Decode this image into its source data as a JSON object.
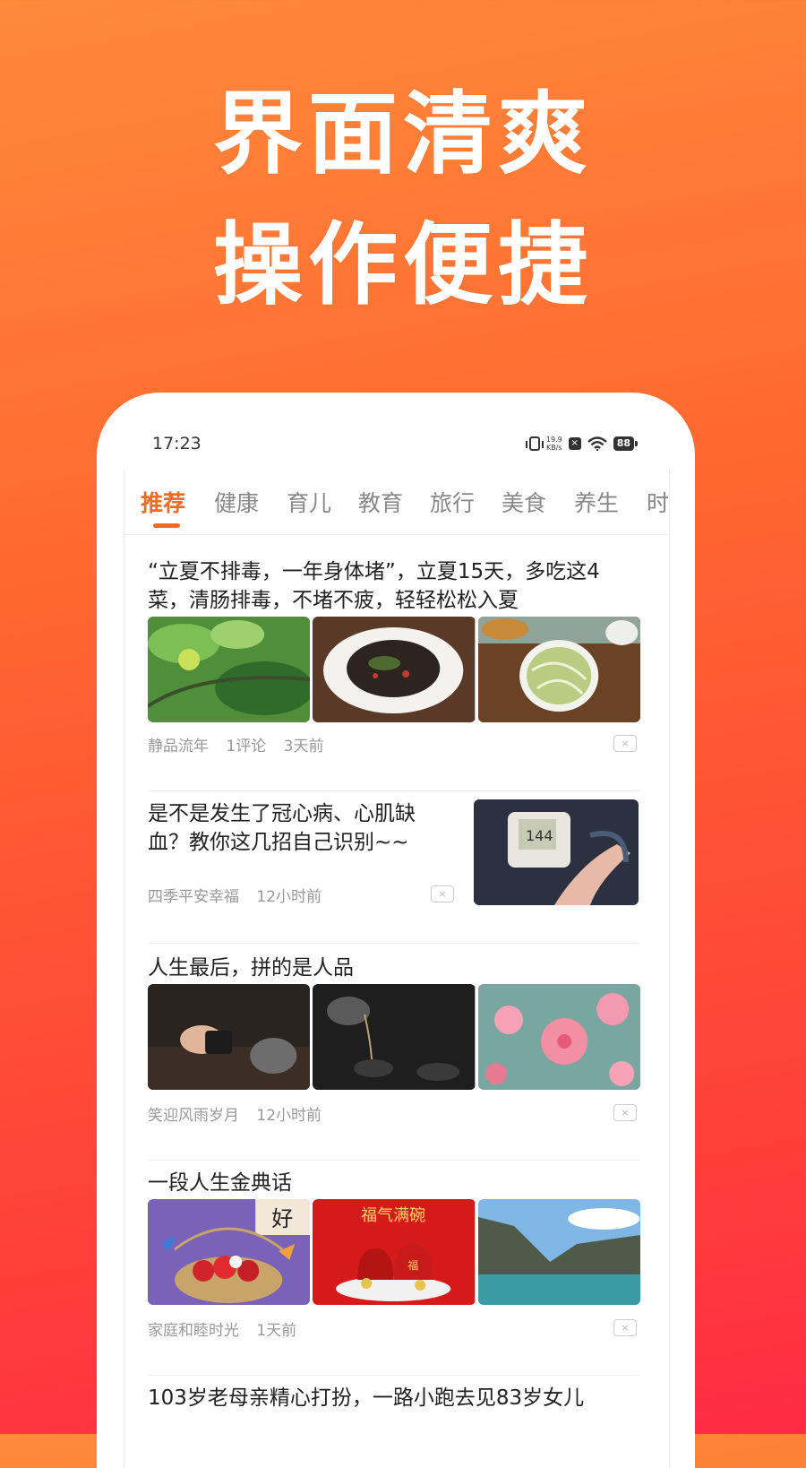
{
  "promo": {
    "line1": "界面清爽",
    "line2": "操作便捷"
  },
  "status": {
    "time": "17:23",
    "speed_val": "19.9",
    "speed_unit": "KB/s",
    "battery": "88"
  },
  "tabs": [
    "推荐",
    "健康",
    "育儿",
    "教育",
    "旅行",
    "美食",
    "养生",
    "时"
  ],
  "articles": [
    {
      "title": "“立夏不排毒，一年身体堵”，立夏15天，多吃这4菜，清肠排毒，不堵不疲，轻轻松松入夏",
      "author": "静品流年",
      "comments": "1评论",
      "time": "3天前"
    },
    {
      "title": "是不是发生了冠心病、心肌缺血？教你这几招自己识别~~",
      "author": "四季平安幸福",
      "time": "12小时前",
      "bp_reading": "144"
    },
    {
      "title": "人生最后，拼的是人品",
      "author": "笑迎风雨岁月",
      "time": "12小时前"
    },
    {
      "title": "一段人生金典话",
      "author": "家庭和睦时光",
      "time": "1天前",
      "img1_text": "好",
      "img2_text": "福气满碗",
      "img2_bag": "福"
    },
    {
      "title": "103岁老母亲精心打扮，一路小跑去见83岁女儿"
    }
  ],
  "close_glyph": "×",
  "colors": {
    "accent": "#f26b22",
    "bg_top": "#ff8a3a",
    "bg_bottom": "#ff2b45"
  }
}
